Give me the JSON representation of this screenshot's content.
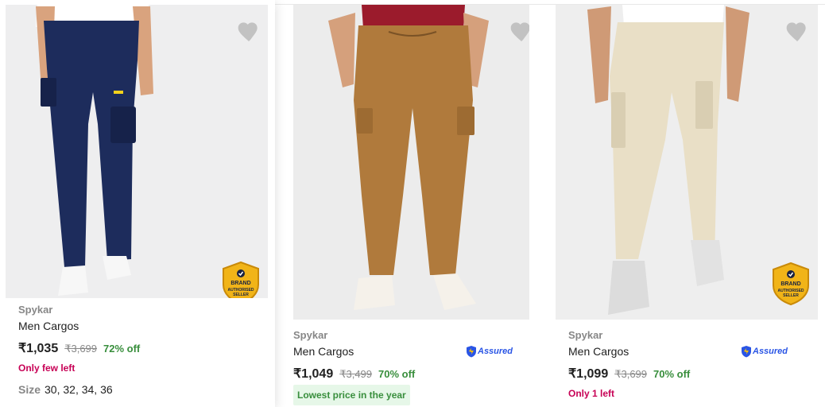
{
  "products": [
    {
      "brand": "Spykar",
      "title": "Men Cargos",
      "price": "₹1,035",
      "mrp": "₹3,699",
      "discount": "72% off",
      "stock_note": "Only few left",
      "size_label": "Size",
      "sizes": "30, 32, 34, 36",
      "pant_color": "#1d2c5c",
      "badge": "BRAND AUTHORISED SELLER"
    },
    {
      "brand": "Spykar",
      "title": "Men Cargos",
      "price": "₹1,049",
      "mrp": "₹3,499",
      "discount": "70% off",
      "highlight": "Lowest price in the year",
      "assured": "Assured",
      "pant_color": "#b07a3c",
      "shirt_color": "#9b1b2c"
    },
    {
      "brand": "Spykar",
      "title": "Men Cargos",
      "price": "₹1,099",
      "mrp": "₹3,699",
      "discount": "70% off",
      "stock_note": "Only 1 left",
      "assured": "Assured",
      "pant_color": "#e9dfc6",
      "badge": "BRAND AUTHORISED SELLER"
    }
  ],
  "badge_text": {
    "line1": "BRAND",
    "line2": "AUTHORISED",
    "line3": "SELLER"
  },
  "colors": {
    "accent": "#2874f0",
    "discount": "#388e3c",
    "stock": "#c70055",
    "assured": "#2a55e5"
  },
  "icons": {
    "wishlist": "heart-icon",
    "assured": "assured-shield-icon",
    "badge": "brand-authorised-badge-icon"
  }
}
